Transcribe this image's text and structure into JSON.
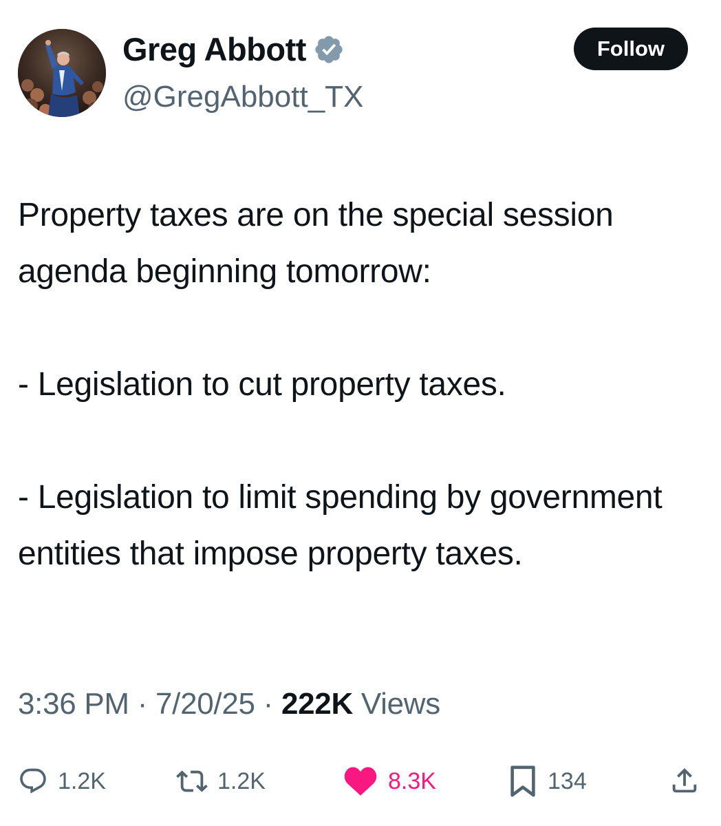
{
  "author": {
    "display_name": "Greg Abbott",
    "handle": "@GregAbbott_TX",
    "verified": true
  },
  "follow_button_label": "Follow",
  "tweet": {
    "paragraphs": [
      "Property taxes are on the special session agenda beginning tomorrow:",
      "- Legislation to cut property taxes.",
      "- Legislation to limit spending by government entities that impose property taxes."
    ]
  },
  "meta": {
    "time": "3:36 PM",
    "separator": "·",
    "date": "7/20/25",
    "views_count": "222K",
    "views_label": "Views"
  },
  "actions": {
    "replies": "1.2K",
    "reposts": "1.2K",
    "likes": "8.3K",
    "bookmarks": "134"
  },
  "colors": {
    "text": "#0f1419",
    "secondary": "#536471",
    "like": "#f91880",
    "verified_badge": "#829aab"
  },
  "icons": {
    "avatar": "profile-photo",
    "verified": "verified-badge-icon",
    "reply": "reply-icon",
    "repost": "repost-icon",
    "like": "heart-icon",
    "bookmark": "bookmark-icon",
    "share": "share-icon"
  }
}
